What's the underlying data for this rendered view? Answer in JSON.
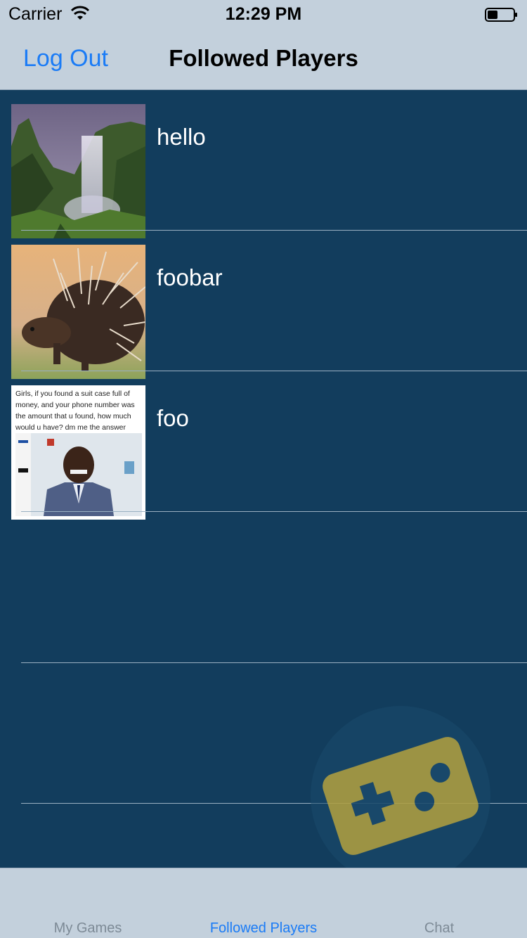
{
  "status_bar": {
    "carrier": "Carrier",
    "time": "12:29 PM",
    "icons": [
      "wifi-icon",
      "battery-icon"
    ]
  },
  "nav": {
    "left_button": "Log Out",
    "title": "Followed Players"
  },
  "players": [
    {
      "name": "hello",
      "avatar": "waterfall-photo"
    },
    {
      "name": "foobar",
      "avatar": "porcupine-photo"
    },
    {
      "name": "foo",
      "avatar": "meme-image",
      "avatar_text": "Girls, if you found a suit case full of money, and your phone number was the amount that u found, how much would u have? dm me the answer"
    }
  ],
  "tabs": [
    {
      "label": "My Games",
      "selected": false
    },
    {
      "label": "Followed Players",
      "selected": true
    },
    {
      "label": "Chat",
      "selected": false
    }
  ],
  "colors": {
    "background": "#123d5d",
    "bars": "#c3d0dc",
    "accent": "#1a7bf6",
    "watermark": "#c9ae3a"
  },
  "watermark_icon": "gamepad-icon"
}
